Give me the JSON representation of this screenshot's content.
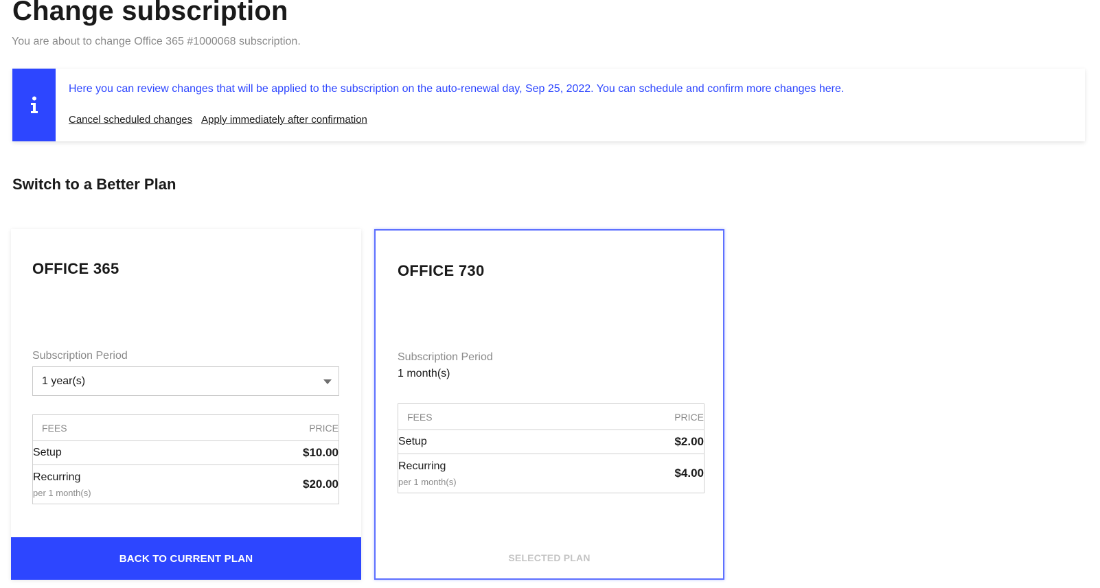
{
  "page": {
    "title": "Change subscription",
    "subtitle": "You are about to change Office 365 #1000068 subscription."
  },
  "notice": {
    "icon": "info-icon",
    "text": "Here you can review changes that will be applied to the subscription on the auto-renewal day, Sep 25, 2022. You can schedule and confirm more changes here.",
    "links": [
      "Cancel scheduled changes",
      "Apply immediately after confirmation"
    ],
    "colors": {
      "accent": "#2d46ff"
    }
  },
  "section": {
    "title": "Switch to a Better Plan"
  },
  "plans": [
    {
      "name": "OFFICE 365",
      "period_label": "Subscription Period",
      "period_value": "1 year(s)",
      "fees_header": {
        "fees": "FEES",
        "price": "PRICE"
      },
      "fees": [
        {
          "name": "Setup",
          "price": "$10.00"
        },
        {
          "name": "Recurring",
          "sub": "per 1 month(s)",
          "price": "$20.00"
        }
      ],
      "button": "BACK TO CURRENT PLAN"
    },
    {
      "name": "OFFICE 730",
      "period_label": "Subscription Period",
      "period_value": "1 month(s)",
      "fees_header": {
        "fees": "FEES",
        "price": "PRICE"
      },
      "fees": [
        {
          "name": "Setup",
          "price": "$2.00"
        },
        {
          "name": "Recurring",
          "sub": "per 1 month(s)",
          "price": "$4.00"
        }
      ],
      "button": "SELECTED PLAN"
    }
  ]
}
